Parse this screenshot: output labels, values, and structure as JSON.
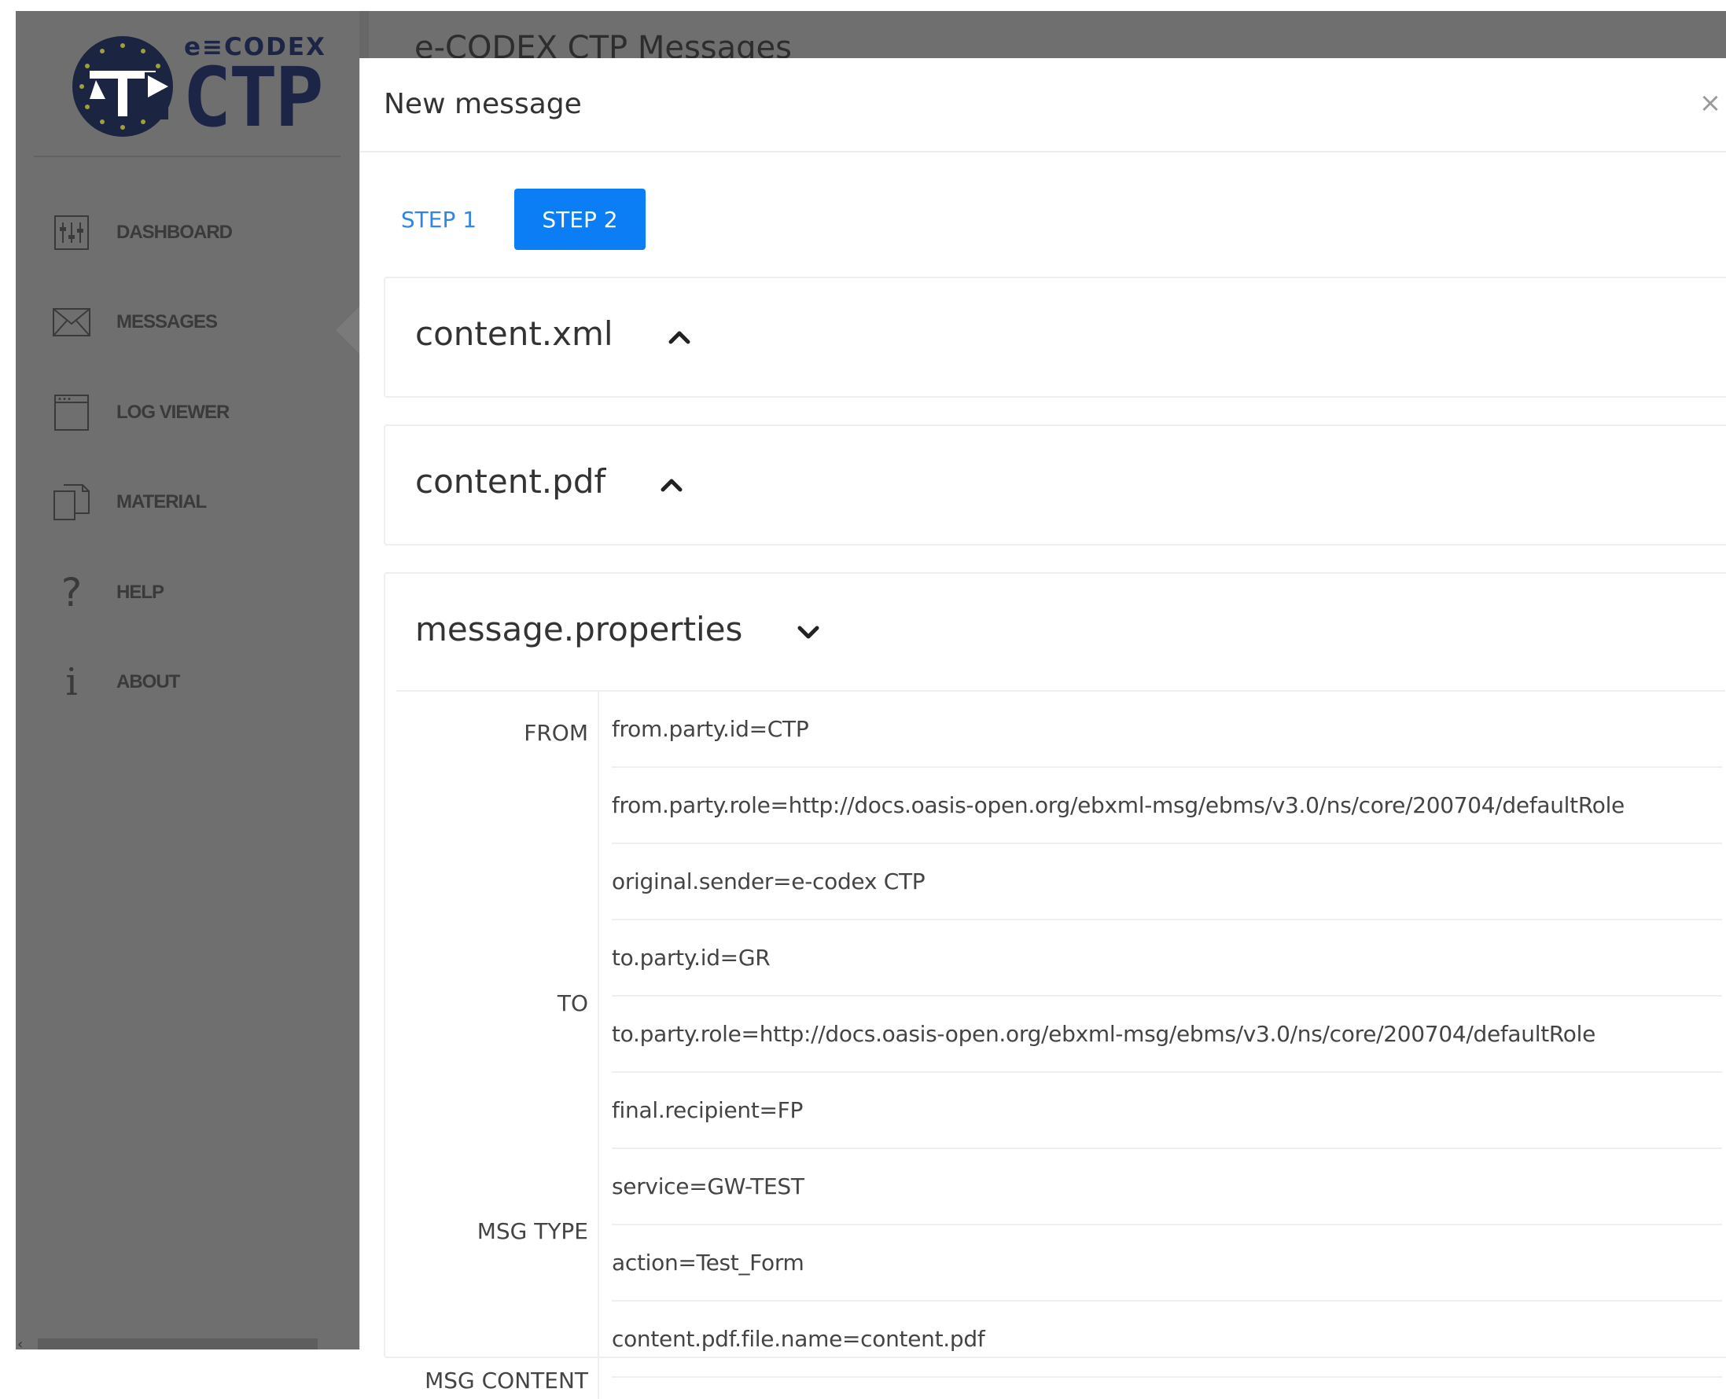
{
  "app": {
    "logo_small_text": "e≡CODEX",
    "logo_big_text": "CTP",
    "background_title": "e-CODEX CTP Messages"
  },
  "sidebar": {
    "items": [
      {
        "label": "DASHBOARD",
        "icon": "sliders-icon"
      },
      {
        "label": "MESSAGES",
        "icon": "envelope-icon"
      },
      {
        "label": "LOG VIEWER",
        "icon": "window-icon"
      },
      {
        "label": "MATERIAL",
        "icon": "documents-icon"
      },
      {
        "label": "HELP",
        "icon": "question-icon"
      },
      {
        "label": "ABOUT",
        "icon": "info-icon"
      }
    ]
  },
  "modal": {
    "title": "New message",
    "close_icon": "close-icon",
    "steps": [
      {
        "label": "STEP 1",
        "active": false
      },
      {
        "label": "STEP 2",
        "active": true
      }
    ],
    "sections": [
      {
        "title": "content.xml",
        "state": "collapsed",
        "chevron": "chevron-up-icon"
      },
      {
        "title": "content.pdf",
        "state": "collapsed",
        "chevron": "chevron-up-icon"
      },
      {
        "title": "message.properties",
        "state": "expanded",
        "chevron": "chevron-down-icon"
      }
    ],
    "properties": {
      "groups": [
        "FROM",
        "TO",
        "MSG TYPE",
        "MSG CONTENT"
      ],
      "rows": [
        "from.party.id=CTP",
        "from.party.role=http://docs.oasis-open.org/ebxml-msg/ebms/v3.0/ns/core/200704/defaultRole",
        "original.sender=e-codex CTP",
        "to.party.id=GR",
        "to.party.role=http://docs.oasis-open.org/ebxml-msg/ebms/v3.0/ns/core/200704/defaultRole",
        "final.recipient=FP",
        "service=GW-TEST",
        "action=Test_Form",
        "content.pdf.file.name=content.pdf"
      ]
    }
  },
  "colors": {
    "overlay": "#6f6f6f",
    "primary": "#0b7ef5",
    "link": "#2f86e8",
    "logo_navy": "#1c2546"
  }
}
